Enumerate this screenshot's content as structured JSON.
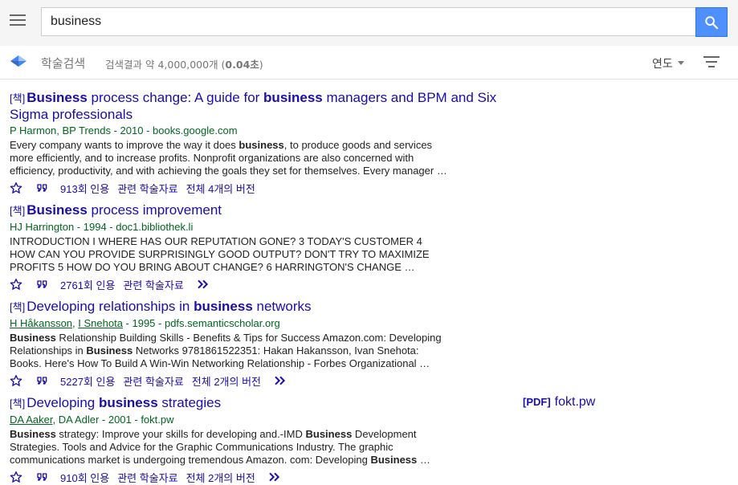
{
  "search": {
    "query": "business"
  },
  "subbar": {
    "brand": "학술검색",
    "count_prefix": "검색결과 약 4,000,000개 (",
    "count_time": "0.04초",
    "count_suffix": ")",
    "year_filter": "연도"
  },
  "results": [
    {
      "type": "[책]",
      "title_lines": [
        [
          {
            "t": "Business",
            "b": true
          },
          {
            "t": " process change: A guide for ",
            "b": false
          },
          {
            "t": "business",
            "b": true
          },
          {
            "t": " managers and BPM and Six",
            "b": false
          }
        ],
        [
          {
            "t": "Sigma professionals",
            "b": false
          }
        ]
      ],
      "authors": [
        {
          "t": "P Harmon, BP Trends",
          "link": false
        },
        {
          "t": " - 2010 - books.google.com",
          "link": false
        }
      ],
      "snippet_lines": [
        [
          {
            "t": "Every company wants to improve the way it does ",
            "b": false
          },
          {
            "t": "business",
            "b": true
          },
          {
            "t": ", to produce goods and services",
            "b": false
          }
        ],
        [
          {
            "t": "more efficiently, and to increase profits. Nonprofit organizations are also concerned with",
            "b": false
          }
        ],
        [
          {
            "t": "efficiency, productivity, and with achieving the goals they set for themselves. Every manager …",
            "b": false
          }
        ]
      ],
      "actions": [
        "913회 인용",
        "관련 학술자료",
        "전체 4개의 버전"
      ],
      "has_more": false
    },
    {
      "type": "[책]",
      "title_lines": [
        [
          {
            "t": "Business",
            "b": true
          },
          {
            "t": " process improvement",
            "b": false
          }
        ]
      ],
      "authors": [
        {
          "t": "HJ Harrington - 1994 - doc1.bibliothek.li",
          "link": false
        }
      ],
      "snippet_lines": [
        [
          {
            "t": "INTRODUCTION I WHERE HAS OUR REPUTATION GONE? 3 TODAY'S CUSTOMER 4",
            "b": false
          }
        ],
        [
          {
            "t": "HOW CAN YOU PROVIDE SURPRISINGLY GOOD OUTPUT? DON'T TRY TO MAXIMIZE",
            "b": false
          }
        ],
        [
          {
            "t": "PROFITS 5 HOW DO YOU BRING ABOUT CHANGE? 6 HARRINGTON'S CHANGE …",
            "b": false
          }
        ]
      ],
      "actions": [
        "2761회 인용",
        "관련 학술자료"
      ],
      "has_more": true
    },
    {
      "type": "[책]",
      "title_lines": [
        [
          {
            "t": "Developing relationships in ",
            "b": false
          },
          {
            "t": "business",
            "b": true
          },
          {
            "t": " networks",
            "b": false
          }
        ]
      ],
      "authors": [
        {
          "t": "H Håkansson",
          "link": true
        },
        {
          "t": ", ",
          "link": false
        },
        {
          "t": "I Snehota",
          "link": true
        },
        {
          "t": " - 1995 - pdfs.semanticscholar.org",
          "link": false
        }
      ],
      "snippet_lines": [
        [
          {
            "t": "Business",
            "b": true
          },
          {
            "t": " Relationship Building Skills - Benefits & Tips for Success Amazon.com: Developing",
            "b": false
          }
        ],
        [
          {
            "t": "Relationships in ",
            "b": false
          },
          {
            "t": "Business",
            "b": true
          },
          {
            "t": " Networks 9781861522351: Hakan Hakansson, Ivan Snehota:",
            "b": false
          }
        ],
        [
          {
            "t": "Books. Here's How To Build A Win-Win Networking Relationship - Forbes Organizational …",
            "b": false
          }
        ]
      ],
      "actions": [
        "5227회 인용",
        "관련 학술자료",
        "전체 2개의 버전"
      ],
      "has_more": true
    },
    {
      "type": "[책]",
      "title_lines": [
        [
          {
            "t": "Developing ",
            "b": false
          },
          {
            "t": "business",
            "b": true
          },
          {
            "t": " strategies",
            "b": false
          }
        ]
      ],
      "authors": [
        {
          "t": "DA Aaker",
          "link": true
        },
        {
          "t": ", DA Adler - 2001 - fokt.pw",
          "link": false
        }
      ],
      "snippet_lines": [
        [
          {
            "t": "Business",
            "b": true
          },
          {
            "t": " strategy: Improve your skills for developing and.-IMD ",
            "b": false
          },
          {
            "t": "Business",
            "b": true
          },
          {
            "t": " Development",
            "b": false
          }
        ],
        [
          {
            "t": "Strategies. Tools and Advice for the Graphic Communications Industry. The graphic",
            "b": false
          }
        ],
        [
          {
            "t": "communications market is undergoing tremendous Amazon. com: Developing ",
            "b": false
          },
          {
            "t": "Business",
            "b": true
          },
          {
            "t": " …",
            "b": false
          }
        ]
      ],
      "actions": [
        "910회 인용",
        "관련 학술자료",
        "전체 2개의 버전"
      ],
      "has_more": true,
      "side_link": {
        "tag": "[PDF]",
        "text": "fokt.pw"
      }
    }
  ]
}
